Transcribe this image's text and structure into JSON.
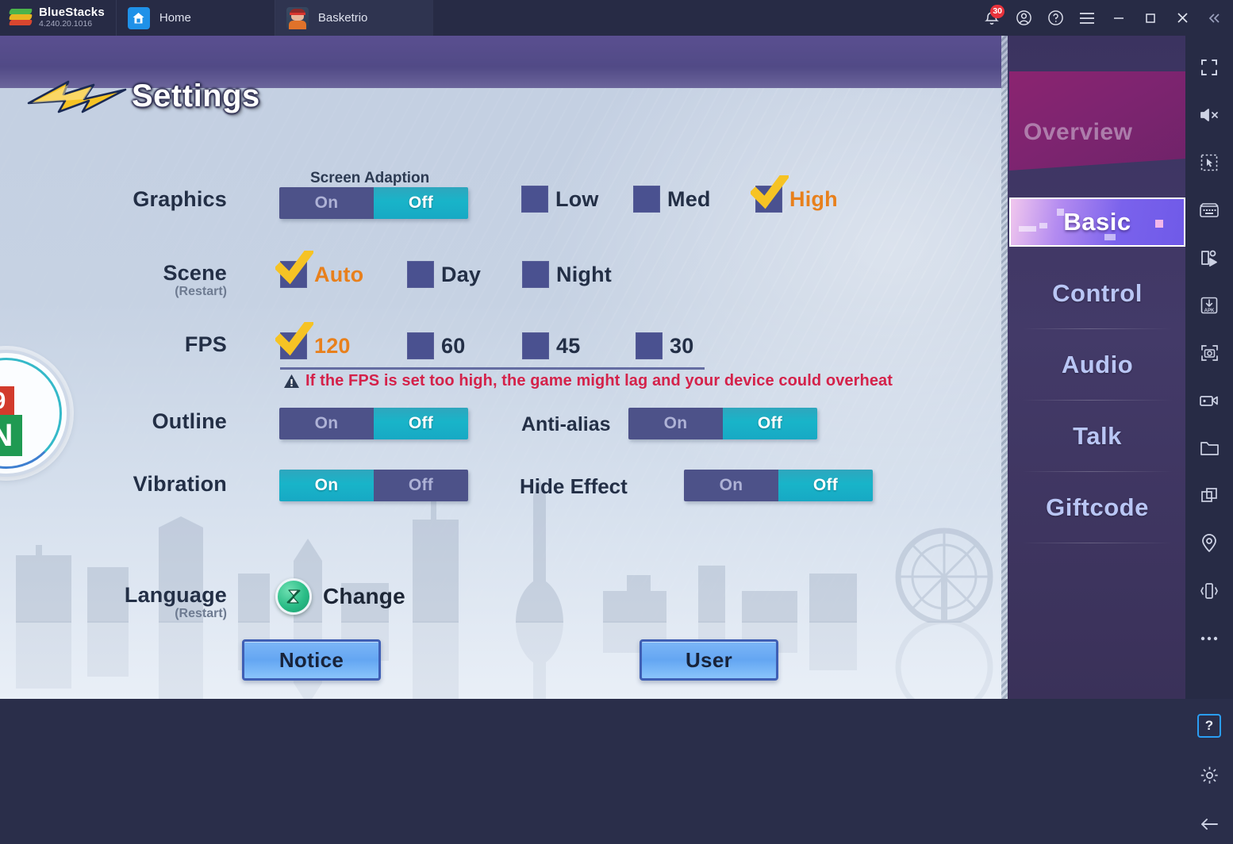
{
  "titlebar": {
    "brand_name": "BlueStacks",
    "version": "4.240.20.1016",
    "tabs": [
      {
        "label": "Home",
        "icon": "home-icon"
      },
      {
        "label": "Basketrio",
        "icon": "game-avatar-icon"
      }
    ],
    "notification_count": "30",
    "controls": [
      {
        "name": "notifications-icon"
      },
      {
        "name": "account-icon"
      },
      {
        "name": "help-icon"
      },
      {
        "name": "menu-icon"
      },
      {
        "name": "minimize-icon"
      },
      {
        "name": "maximize-icon"
      },
      {
        "name": "close-icon"
      },
      {
        "name": "collapse-icon"
      }
    ]
  },
  "game": {
    "header_title": "Settings",
    "rows": {
      "graphics": {
        "label": "Graphics",
        "screen_adaption_label": "Screen Adaption",
        "toggle": {
          "on": "On",
          "off": "Off",
          "value": "Off"
        },
        "quality": [
          {
            "label": "Low",
            "checked": false
          },
          {
            "label": "Med",
            "checked": false
          },
          {
            "label": "High",
            "checked": true
          }
        ]
      },
      "scene": {
        "label": "Scene",
        "sub": "(Restart)",
        "options": [
          {
            "label": "Auto",
            "checked": true
          },
          {
            "label": "Day",
            "checked": false
          },
          {
            "label": "Night",
            "checked": false
          }
        ]
      },
      "fps": {
        "label": "FPS",
        "options": [
          {
            "label": "120",
            "checked": true
          },
          {
            "label": "60",
            "checked": false
          },
          {
            "label": "45",
            "checked": false
          },
          {
            "label": "30",
            "checked": false
          }
        ],
        "warning": "If the FPS is set too high, the game might lag and your device could overheat"
      },
      "outline": {
        "label": "Outline",
        "on": "On",
        "off": "Off",
        "value": "Off"
      },
      "antialias": {
        "label": "Anti-alias",
        "on": "On",
        "off": "Off",
        "value": "Off"
      },
      "vibration": {
        "label": "Vibration",
        "on": "On",
        "off": "Off",
        "value": "On"
      },
      "hide_effect": {
        "label": "Hide Effect",
        "on": "On",
        "off": "Off",
        "value": "Off"
      },
      "language": {
        "label": "Language",
        "sub": "(Restart)",
        "change_label": "Change"
      }
    },
    "buttons": {
      "notice": "Notice",
      "user": "User"
    },
    "sidebar": {
      "overview_label": "Overview",
      "items": [
        {
          "label": "Basic",
          "selected": true
        },
        {
          "label": "Control",
          "selected": false
        },
        {
          "label": "Audio",
          "selected": false
        },
        {
          "label": "Talk",
          "selected": false
        },
        {
          "label": "Giftcode",
          "selected": false
        }
      ]
    }
  },
  "toolbar": {
    "items": [
      {
        "name": "fullscreen-icon"
      },
      {
        "name": "mute-icon"
      },
      {
        "name": "multi-instance-icon"
      },
      {
        "name": "keyboard-controls-icon"
      },
      {
        "name": "macro-script-icon"
      },
      {
        "name": "install-apk-icon"
      },
      {
        "name": "screenshot-icon"
      },
      {
        "name": "record-video-icon"
      },
      {
        "name": "media-folder-icon"
      },
      {
        "name": "copy-instance-icon"
      },
      {
        "name": "location-icon"
      },
      {
        "name": "shake-icon"
      },
      {
        "name": "more-icon"
      },
      {
        "name": "help-icon",
        "label": "?"
      },
      {
        "name": "settings-gear-icon"
      },
      {
        "name": "back-arrow-icon"
      }
    ]
  },
  "colors": {
    "accent_orange": "#e8801c",
    "toggle_on": "#18b4c9",
    "toggle_off": "#4d5289",
    "warning_red": "#d4224a",
    "titlebar_bg": "#272b45",
    "sidebar_purple": "#433a68",
    "overview_magenta": "#7e2470"
  }
}
